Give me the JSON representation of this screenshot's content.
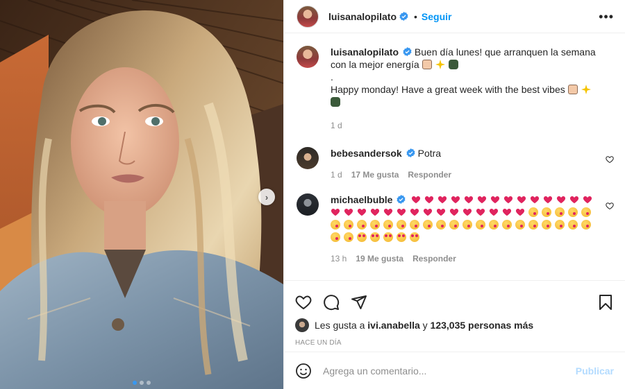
{
  "header": {
    "username": "luisanalopilato",
    "separator": "•",
    "follow_label": "Seguir",
    "more_label": "•••"
  },
  "carousel": {
    "next_label": "›",
    "slide_count": 3,
    "active_slide": 1
  },
  "caption": {
    "username": "luisanalopilato",
    "text_es": "Buen día lunes! que arranquen la semana con la mejor energía",
    "dot": ".",
    "text_en": "Happy monday! Have a great week with the best vibes",
    "emojis": [
      "raising-hands",
      "sparkles",
      "goggles"
    ],
    "time": "1 d"
  },
  "comments": [
    {
      "username": "bebesandersok",
      "verified": true,
      "text": "Potra",
      "time": "1 d",
      "likes": "17 Me gusta",
      "reply_label": "Responder"
    },
    {
      "username": "michaelbuble",
      "verified": true,
      "text": "",
      "emoji_summary": {
        "hearts": 29,
        "kiss_faces": 27,
        "heart_eye_faces": 5
      },
      "time": "13 h",
      "likes": "19 Me gusta",
      "reply_label": "Responder"
    }
  ],
  "likes": {
    "prefix": "Les gusta a",
    "user": "ivi.anabella",
    "connector": "y",
    "count": "123,035 personas más"
  },
  "time_ago": "HACE UN DÍA",
  "comment_box": {
    "placeholder": "Agrega un comentario...",
    "publish_label": "Publicar"
  },
  "colors": {
    "link": "#0095f6",
    "muted": "#8e8e8e",
    "verified": "#3897f0",
    "publish_disabled": "#b3dbff",
    "heart": "#e0245e"
  },
  "icons": [
    "more-icon",
    "heart-icon",
    "comment-icon",
    "share-icon",
    "bookmark-icon",
    "smile-icon",
    "verified-icon",
    "chevron-right-icon"
  ]
}
